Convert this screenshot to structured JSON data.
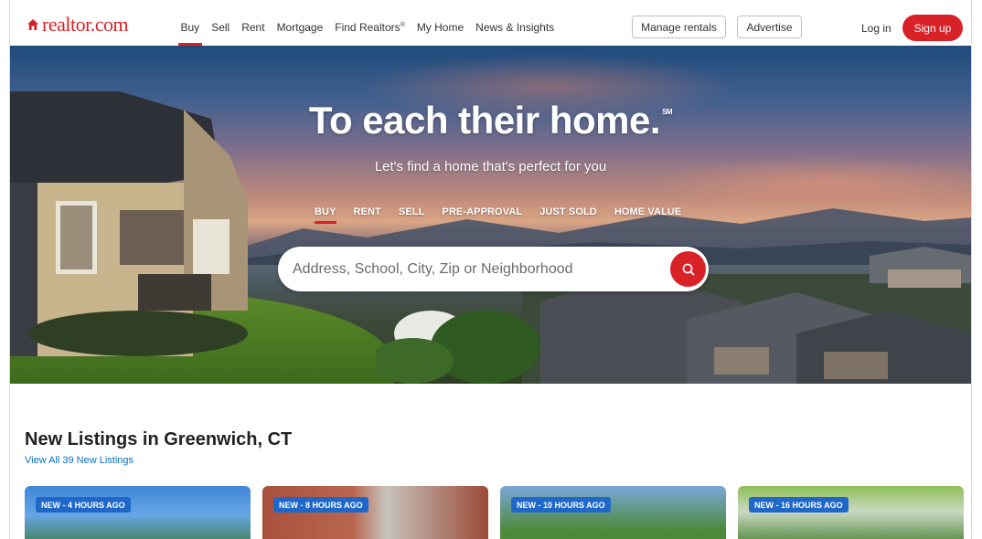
{
  "header": {
    "logo_text": "realtor.com",
    "nav": [
      {
        "label": "Buy",
        "active": true
      },
      {
        "label": "Sell"
      },
      {
        "label": "Rent"
      },
      {
        "label": "Mortgage"
      },
      {
        "label": "Find Realtors"
      },
      {
        "label": "My Home"
      },
      {
        "label": "News & Insights"
      }
    ],
    "find_realtors_mark": "®",
    "manage_rentals": "Manage rentals",
    "advertise": "Advertise",
    "login": "Log in",
    "signup": "Sign up"
  },
  "hero": {
    "title": "To each their home.",
    "title_mark": "SM",
    "subtitle": "Let's find a home that's perfect for you",
    "tabs": [
      {
        "label": "BUY",
        "active": true
      },
      {
        "label": "RENT"
      },
      {
        "label": "SELL"
      },
      {
        "label": "PRE-APPROVAL"
      },
      {
        "label": "JUST SOLD"
      },
      {
        "label": "HOME VALUE"
      }
    ],
    "search_placeholder": "Address, School, City, Zip or Neighborhood"
  },
  "listings": {
    "title": "New Listings in Greenwich, CT",
    "view_all": "View All 39 New Listings",
    "cards": [
      {
        "badge": "NEW - 4 HOURS AGO"
      },
      {
        "badge": "NEW - 8 HOURS AGO"
      },
      {
        "badge": "NEW - 10 HOURS AGO"
      },
      {
        "badge": "NEW - 16 HOURS AGO"
      }
    ]
  },
  "colors": {
    "brand_red": "#d92228",
    "badge_blue": "#1f68c9",
    "link_blue": "#0a6ec2"
  },
  "icons": [
    "house-logo-icon",
    "search-icon"
  ]
}
